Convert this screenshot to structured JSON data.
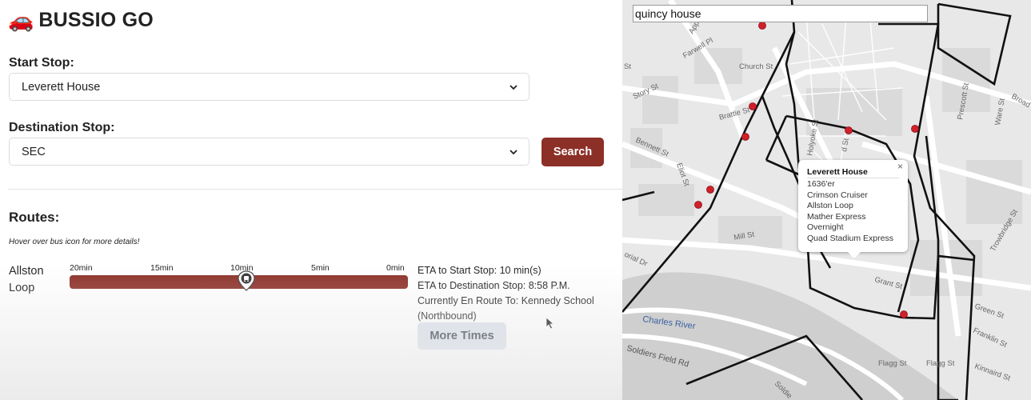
{
  "app": {
    "logo_icon": "car-icon",
    "title": "BUSSIO GO"
  },
  "form": {
    "start_label": "Start Stop:",
    "start_value": "Leverett House",
    "destination_label": "Destination Stop:",
    "destination_value": "SEC",
    "search_label": "Search"
  },
  "routes": {
    "heading": "Routes:",
    "hint": "Hover over bus icon for more details!",
    "items": [
      {
        "name": "Allston Loop",
        "timeline_ticks": [
          "20min",
          "15min",
          "10min",
          "5min",
          "0min"
        ],
        "bus_position_min": 10,
        "eta_start": "ETA to Start Stop: 10 min(s)",
        "eta_destination": "ETA to Destination Stop: 8:58 P.M.",
        "en_route": "Currently En Route To: Kennedy School (Northbound)",
        "more_times_label": "More Times"
      }
    ]
  },
  "map": {
    "search_value": "quincy house",
    "popup": {
      "title": "Leverett House",
      "lines": [
        "1636'er",
        "Crimson Cruiser",
        "Allston Loop",
        "Mather Express",
        "Overnight",
        "Quad Stadium Express"
      ],
      "close": "×"
    },
    "labels": {
      "church": "Church St",
      "farwell": "Farwell Pl",
      "story": "Story St",
      "brattle": "Brattle St",
      "bennett": "Bennett St",
      "eliot": "Eliot St",
      "mill": "Mill St",
      "memorial": "orial Dr",
      "charles": "Charles River",
      "soldiers": "Soldiers Field Rd",
      "flagg1": "Flagg St",
      "flagg2": "Flagg St",
      "prescott": "Prescott St",
      "ware": "Ware St",
      "broad": "Broad",
      "trowbridge": "Trowbridge St",
      "green": "Green St",
      "franklin": "Franklin St",
      "kinnaird": "Kinnaird St",
      "grant": "Grant St",
      "holyoke": "Holyoke St",
      "dst": "d St",
      "app": "App",
      "soldie": "Soldie",
      "st": "St"
    },
    "colors": {
      "route": "#111111",
      "stop": "#d0202a",
      "water": "#cfcfcf"
    }
  },
  "colors": {
    "accent": "#8c2f27",
    "more_button": "#dce3ec"
  }
}
